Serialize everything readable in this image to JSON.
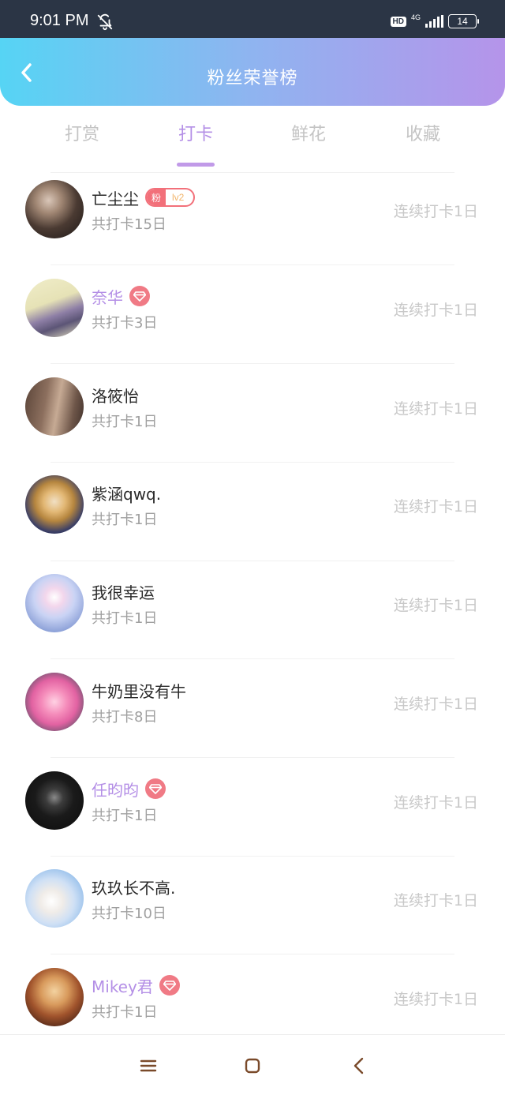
{
  "status_bar": {
    "time": "9:01 PM",
    "hd": "HD",
    "network": "4G",
    "battery": "14"
  },
  "header": {
    "title": "粉丝荣誉榜"
  },
  "tabs": [
    {
      "label": "打赏",
      "active": false
    },
    {
      "label": "打卡",
      "active": true
    },
    {
      "label": "鲜花",
      "active": false
    },
    {
      "label": "收藏",
      "active": false
    }
  ],
  "badges": {
    "fan_tag": "粉",
    "fan_level": "lv2"
  },
  "list": [
    {
      "name": "亡尘尘",
      "total": "共打卡15日",
      "streak": "连续打卡1日",
      "badge": "fan",
      "vip": false
    },
    {
      "name": "奈华",
      "total": "共打卡3日",
      "streak": "连续打卡1日",
      "badge": "diamond",
      "vip": true
    },
    {
      "name": "洛筱怡",
      "total": "共打卡1日",
      "streak": "连续打卡1日",
      "badge": "none",
      "vip": false
    },
    {
      "name": "紫涵qwq.",
      "total": "共打卡1日",
      "streak": "连续打卡1日",
      "badge": "none",
      "vip": false
    },
    {
      "name": "我很幸运",
      "total": "共打卡1日",
      "streak": "连续打卡1日",
      "badge": "none",
      "vip": false
    },
    {
      "name": "牛奶里没有牛",
      "total": "共打卡8日",
      "streak": "连续打卡1日",
      "badge": "none",
      "vip": false
    },
    {
      "name": "任昀昀",
      "total": "共打卡1日",
      "streak": "连续打卡1日",
      "badge": "diamond",
      "vip": true
    },
    {
      "name": "玖玖长不高.",
      "total": "共打卡10日",
      "streak": "连续打卡1日",
      "badge": "none",
      "vip": false
    },
    {
      "name": "Mikey君",
      "total": "共打卡1日",
      "streak": "连续打卡1日",
      "badge": "diamond",
      "vip": true
    }
  ],
  "colors": {
    "accent": "#b48fe6",
    "header_gradient_start": "#56d4f4",
    "header_gradient_end": "#b594ea",
    "badge_red": "#f2707a"
  }
}
